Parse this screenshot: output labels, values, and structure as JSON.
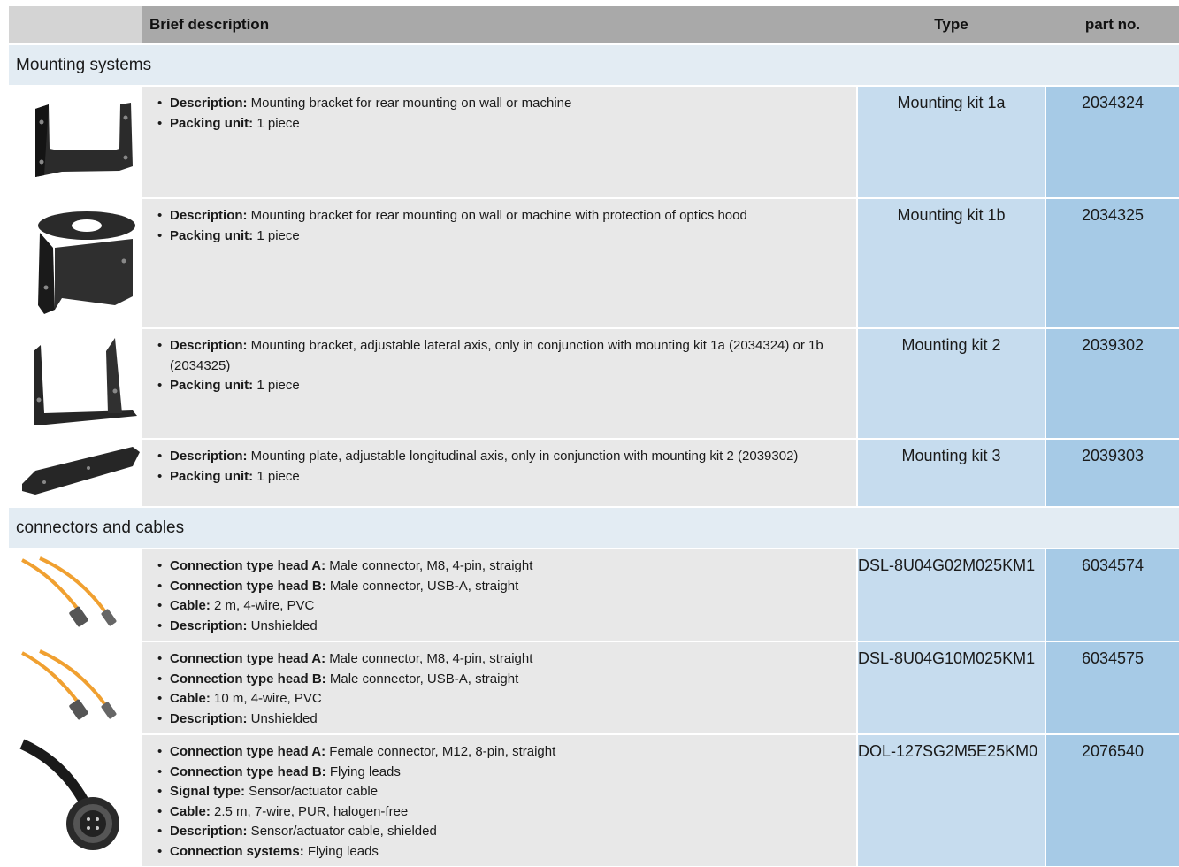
{
  "header": {
    "brief_description": "Brief description",
    "type": "Type",
    "part_no": "part no."
  },
  "sections": [
    {
      "title": "Mounting systems",
      "rows": [
        {
          "icon": "mounting-bracket-icon",
          "items": [
            {
              "label": "Description:",
              "text": " Mounting bracket for rear mounting on wall or machine"
            },
            {
              "label": "Packing unit:",
              "text": " 1 piece"
            }
          ],
          "type": "Mounting kit 1a",
          "part": "2034324"
        },
        {
          "icon": "mounting-bracket-hood-icon",
          "items": [
            {
              "label": "Description:",
              "text": " Mounting bracket for rear mounting on wall or machine with protection of optics hood"
            },
            {
              "label": "Packing unit:",
              "text": " 1 piece"
            }
          ],
          "type": "Mounting kit 1b",
          "part": "2034325"
        },
        {
          "icon": "adjustable-bracket-icon",
          "items": [
            {
              "label": "Description:",
              "text": " Mounting bracket, adjustable lateral axis, only in conjunction with mounting kit 1a (2034324) or 1b (2034325)"
            },
            {
              "label": "Packing unit:",
              "text": " 1 piece"
            }
          ],
          "type": "Mounting kit 2",
          "part": "2039302"
        },
        {
          "icon": "mounting-plate-icon",
          "items": [
            {
              "label": "Description:",
              "text": " Mounting plate, adjustable longitudinal axis, only in conjunction with mounting kit 2 (2039302)"
            },
            {
              "label": "Packing unit:",
              "text": " 1 piece"
            }
          ],
          "type": "Mounting kit 3",
          "part": "2039303"
        }
      ]
    },
    {
      "title": "connectors and cables",
      "rows": [
        {
          "icon": "usb-cable-icon",
          "items": [
            {
              "label": "Connection type head A:",
              "text": " Male connector, M8, 4-pin, straight"
            },
            {
              "label": "Connection type head B:",
              "text": " Male connector, USB-A, straight"
            },
            {
              "label": "Cable:",
              "text": " 2 m, 4-wire, PVC"
            },
            {
              "label": "Description:",
              "text": " Unshielded"
            }
          ],
          "type": "DSL-8U04G02M025KM1",
          "part": "6034574"
        },
        {
          "icon": "usb-cable-icon",
          "items": [
            {
              "label": "Connection type head A:",
              "text": " Male connector, M8, 4-pin, straight"
            },
            {
              "label": "Connection type head B:",
              "text": " Male connector, USB-A, straight"
            },
            {
              "label": "Cable:",
              "text": " 10 m, 4-wire, PVC"
            },
            {
              "label": "Description:",
              "text": " Unshielded"
            }
          ],
          "type": "DSL-8U04G10M025KM1",
          "part": "6034575"
        },
        {
          "icon": "m12-female-connector-icon",
          "items": [
            {
              "label": "Connection type head A:",
              "text": " Female connector, M12, 8-pin, straight"
            },
            {
              "label": "Connection type head B:",
              "text": " Flying leads"
            },
            {
              "label": "Signal type:",
              "text": " Sensor/actuator cable"
            },
            {
              "label": "Cable:",
              "text": " 2.5 m, 7-wire, PUR, halogen-free"
            },
            {
              "label": "Description:",
              "text": " Sensor/actuator cable, shielded"
            },
            {
              "label": "Connection systems:",
              "text": " Flying leads"
            }
          ],
          "type": "DOL-127SG2M5E25KM0",
          "part": "2076540"
        }
      ]
    }
  ]
}
